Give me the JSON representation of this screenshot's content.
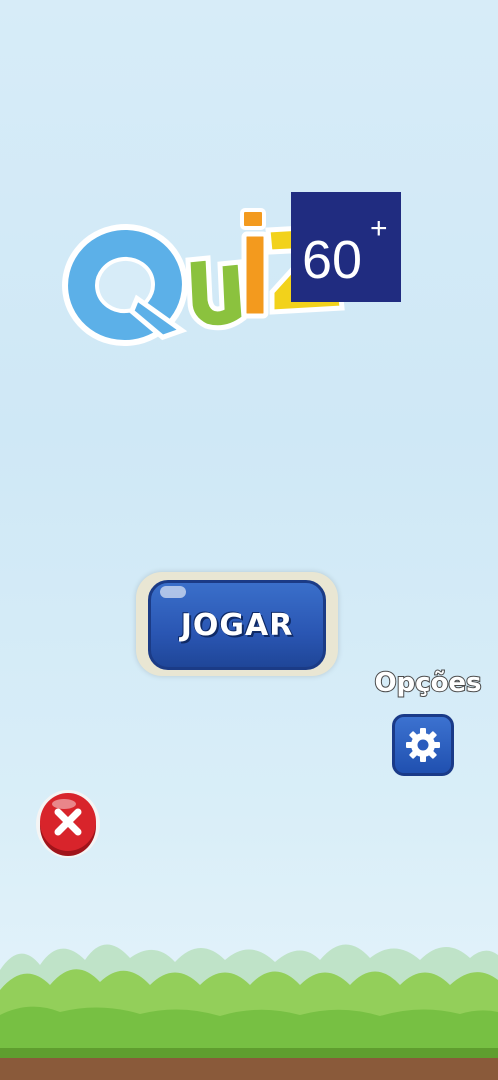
{
  "logo": {
    "text": "Quiz",
    "badge_number": "60",
    "badge_sign": "+"
  },
  "play_button": {
    "label": "JOGAR"
  },
  "options": {
    "label": "Opções",
    "icon": "gear-icon"
  },
  "exit": {
    "icon": "close-icon"
  },
  "colors": {
    "sky": "#d7ecf8",
    "button_blue": "#2a56b3",
    "exit_red": "#d8242b",
    "grass": "#77c043",
    "dirt": "#8a5a3a"
  }
}
